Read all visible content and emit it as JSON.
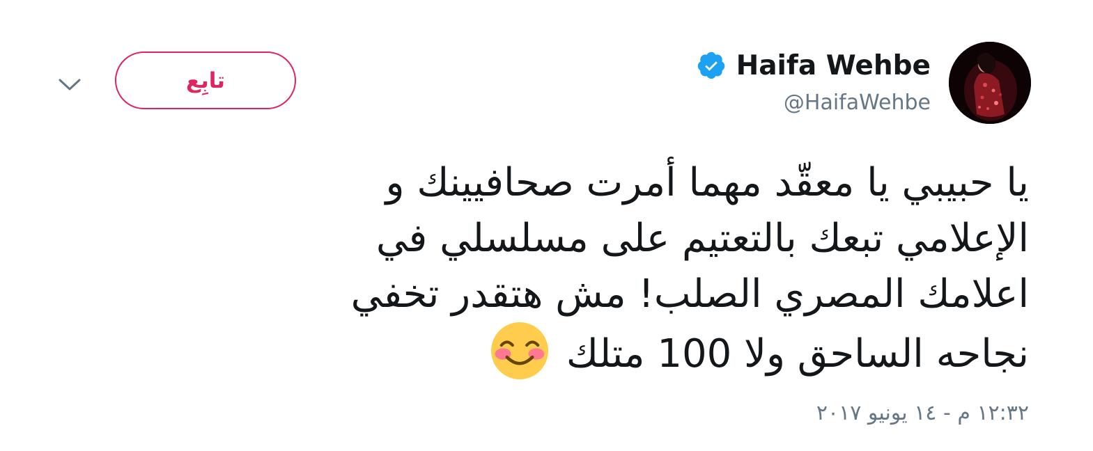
{
  "author": {
    "display_name": "Haifa Wehbe",
    "handle": "@HaifaWehbe",
    "verified": true,
    "avatar_icon": "profile-photo"
  },
  "actions": {
    "follow_label": "تابِع",
    "caret_icon": "chevron-down-icon"
  },
  "tweet": {
    "lines": [
      "يا حبيبي يا معقّد مهما أمرت صحافيينك و",
      "الإعلامي تبعك بالتعتيم على مسلسلي في",
      "اعلامك المصري الصلب!  مش هتقدر تخفي",
      "نجاحه الساحق  ولا 100 متلك"
    ],
    "emoji": "smiling-face-with-smiling-eyes-icon"
  },
  "timestamp": "١٢:٣٢ م - ١٤ يونيو ٢٠١٧",
  "colors": {
    "accent": "#e0245e",
    "verified": "#1da1f2",
    "secondary_text": "#657786",
    "primary_text": "#14171a"
  }
}
